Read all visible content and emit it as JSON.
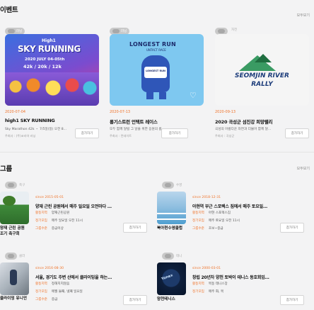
{
  "events_section": {
    "title": "이벤트",
    "more": "모두보기"
  },
  "events": [
    {
      "chip": "러닝",
      "poster_badge": "High1",
      "poster_title": "SKY RUNNING",
      "poster_date": "2020 JULY 04-05th",
      "poster_dist": "42k / 20k / 12k",
      "date": "2020-07-04",
      "title": "high1 SKY RUNNING",
      "desc": "Sky Marathon 42k ・ 7/5일(일) 오전 8...",
      "org": "주최사 : (주)코리아 러닝",
      "join": "참가하기"
    },
    {
      "chip": "러닝",
      "poster_title": "LONGEST RUN",
      "poster_sub": "UNTACT RACE",
      "poster_mascot": "LONGEST RUN",
      "date": "2020-07-13",
      "title": "롱기스트런 언택트 레이스",
      "desc": "모두 함께 달릴 그 날을 위한 응원의 롱...",
      "org": "주최사 : 런데이트",
      "join": "참가하기"
    },
    {
      "tag": "자전",
      "poster_title": "SEOMJIN RIVER",
      "poster_sub": "RALLY",
      "date": "2020-09-13",
      "title": "2020 곡성군 섬진강 희망랠리",
      "desc": "곡성의 아름다운 자연과 더불어 함께 달...",
      "org": "주최사 : 곡성군",
      "join": "참가하기"
    }
  ],
  "groups_section": {
    "title": "그룹",
    "more": "모두보기"
  },
  "groups": [
    {
      "chip_text": "축구",
      "since": "since 2015-05-01",
      "title": "양재 근린 공원에서 매주 일요일 오전마다 ...",
      "rows": [
        {
          "k": "활동지역",
          "v": "양재근린공원"
        },
        {
          "k": "정기모임",
          "v": "매주 일요일 오전 11시"
        },
        {
          "k": "그룹수준",
          "v": "중급이상"
        }
      ],
      "name": "양재 근린 공원 조기 축구회",
      "join": "참가하기"
    },
    {
      "chip_text": "수영",
      "since": "since 2018-12-31",
      "title": "아현역 부근 스포렉스 짐에서 매주 토요일...",
      "rows": [
        {
          "k": "활동지역",
          "v": "아현 스포렉스짐"
        },
        {
          "k": "정기모임",
          "v": "매주 토요일 오전 11시"
        },
        {
          "k": "그룹수준",
          "v": "초보~중급"
        }
      ],
      "name": "북아현수영클럽",
      "join": "참가하기"
    },
    {
      "chip_text": "클라",
      "since": "since 2016-08-30",
      "title": "서울, 경기도 주변 산에서 클라이밍을 하는...",
      "rows": [
        {
          "k": "활동지역",
          "v": "정해지지않음"
        },
        {
          "k": "정기모임",
          "v": "매월 둘째, 넷째 일요일"
        },
        {
          "k": "그룹수준",
          "v": "중급"
        }
      ],
      "name": "클라이밍 유니언",
      "join": "참가하기"
    },
    {
      "chip_text": "테니",
      "since": "since 2000-03-01",
      "title": "창립 20년차 양천 토박이 테니스 동호회입...",
      "rows": [
        {
          "k": "활동지역",
          "v": "목동 테니스장"
        },
        {
          "k": "정기모임",
          "v": "매주 화, 목"
        }
      ],
      "name": "양천테니스",
      "join": "참가하기"
    }
  ],
  "colors": {
    "accent": "#f0742b",
    "chip": "#c9c9c9"
  }
}
